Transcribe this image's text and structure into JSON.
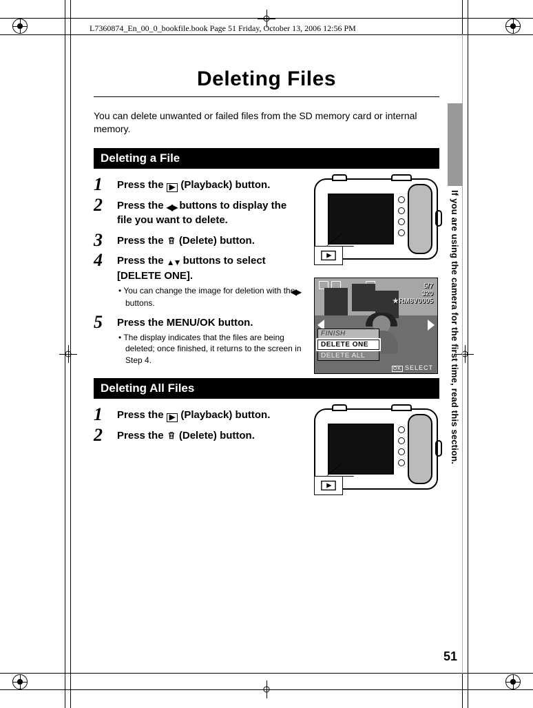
{
  "header": "L7360874_En_00_0_bookfile.book  Page 51  Friday, October 13, 2006  12:56 PM",
  "title": "Deleting Files",
  "intro": "You can delete unwanted or failed files from the SD memory card or internal memory.",
  "side_label": "If you are using the camera for the first time, read this section.",
  "page_number": "51",
  "section1": {
    "heading": "Deleting a File",
    "steps": [
      {
        "n": "1",
        "t_a": "Press the ",
        "t_b": " (Playback) button."
      },
      {
        "n": "2",
        "t_a": "Press the ",
        "t_b": " buttons to display the file you want to delete."
      },
      {
        "n": "3",
        "t_a": "Press the ",
        "t_b": " (Delete) button."
      },
      {
        "n": "4",
        "t_a": "Press the ",
        "t_b": " buttons to select [DELETE ONE].",
        "sub_a": "You can change the image for deletion with the ",
        "sub_b": " buttons."
      },
      {
        "n": "5",
        "t_a": "Press the MENU/OK button.",
        "sub": "The display indicates that the files are being deleted; once finished, it returns to the screen in Step 4."
      }
    ]
  },
  "section2": {
    "heading": "Deleting All Files",
    "steps": [
      {
        "n": "1",
        "t_a": "Press the ",
        "t_b": " (Playback) button."
      },
      {
        "n": "2",
        "t_a": "Press the ",
        "t_b": " (Delete) button."
      }
    ]
  },
  "menu": {
    "counter": "5/7",
    "size": "320",
    "file": "RM8V0005",
    "opt_finish": "FINISH",
    "opt_sel": "DELETE ONE",
    "opt_all": "DELETE ALL",
    "select": "SELECT"
  }
}
